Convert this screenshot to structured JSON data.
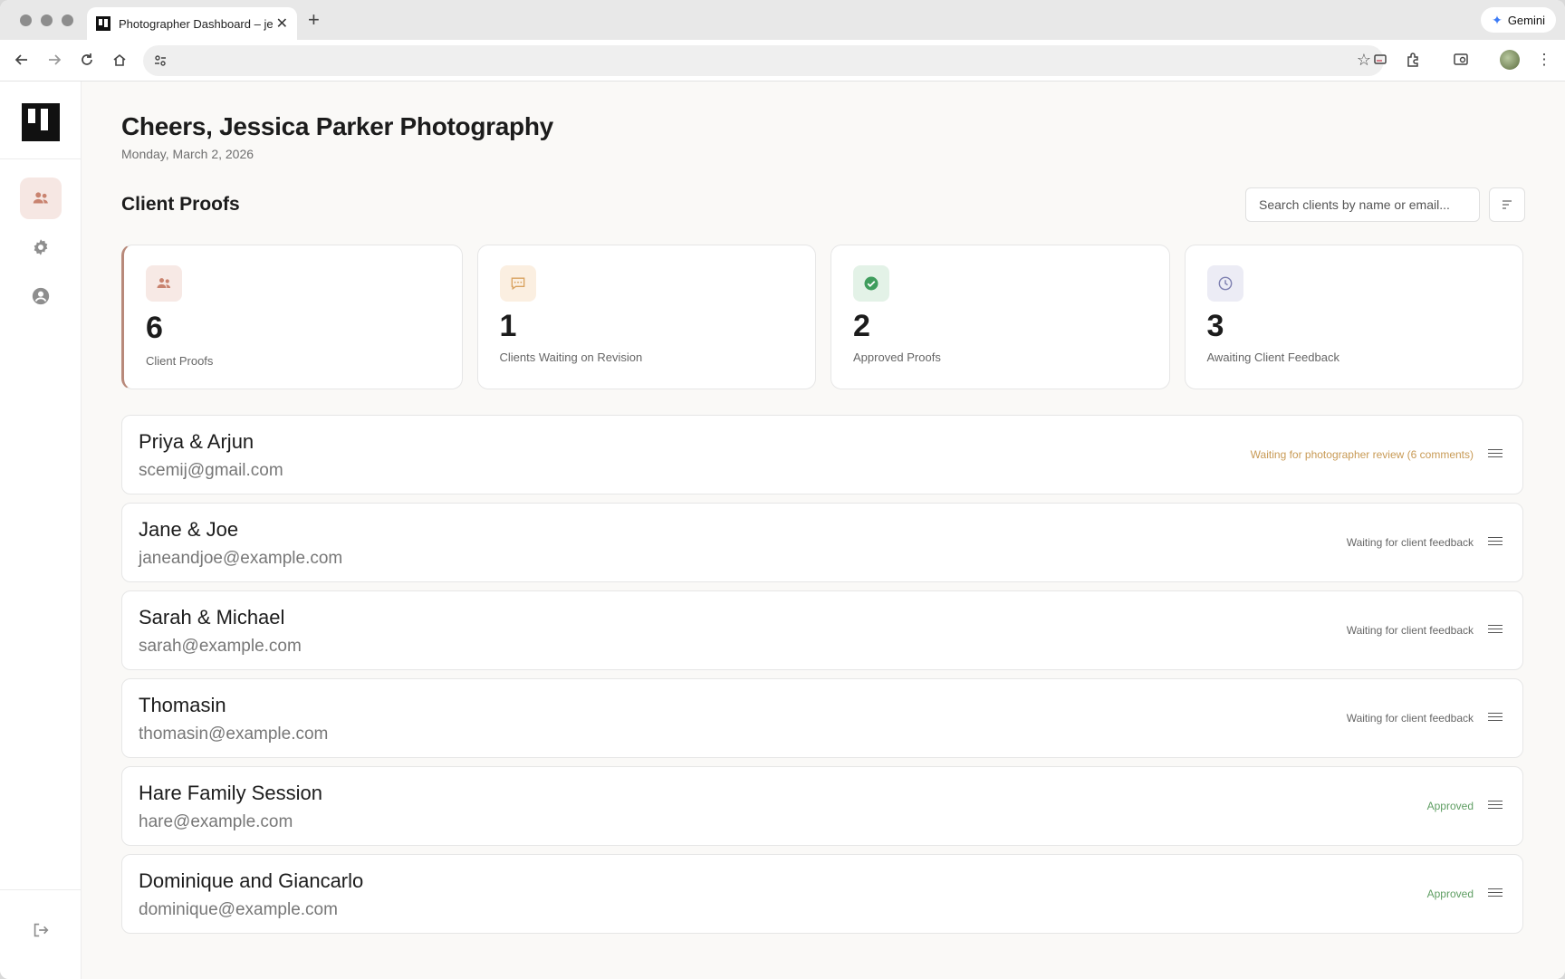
{
  "browser": {
    "tab_title": "Photographer Dashboard – je",
    "gemini_label": "Gemini"
  },
  "header": {
    "greeting": "Cheers, Jessica Parker Photography",
    "date": "Monday, March 2, 2026"
  },
  "section": {
    "title": "Client Proofs",
    "search_placeholder": "Search clients by name or email..."
  },
  "stats": [
    {
      "value": "6",
      "label": "Client Proofs",
      "icon": "users-icon",
      "color": "#c9836f",
      "bg": "#f7e9e5"
    },
    {
      "value": "1",
      "label": "Clients Waiting on Revision",
      "icon": "message-icon",
      "color": "#d9a25f",
      "bg": "#fbefe1"
    },
    {
      "value": "2",
      "label": "Approved Proofs",
      "icon": "check-circle-icon",
      "color": "#3f9d5d",
      "bg": "#e3f2e7"
    },
    {
      "value": "3",
      "label": "Awaiting Client Feedback",
      "icon": "clock-icon",
      "color": "#7d7fb0",
      "bg": "#ececf5"
    }
  ],
  "clients": [
    {
      "name": "Priya & Arjun",
      "email": "scemij@gmail.com",
      "status": "Waiting for photographer review (6 comments)",
      "status_type": "warn"
    },
    {
      "name": "Jane & Joe",
      "email": "janeandjoe@example.com",
      "status": "Waiting for client feedback",
      "status_type": "neutral"
    },
    {
      "name": "Sarah & Michael",
      "email": "sarah@example.com",
      "status": "Waiting for client feedback",
      "status_type": "neutral"
    },
    {
      "name": "Thomasin",
      "email": "thomasin@example.com",
      "status": "Waiting for client feedback",
      "status_type": "neutral"
    },
    {
      "name": "Hare Family Session",
      "email": "hare@example.com",
      "status": "Approved",
      "status_type": "ok"
    },
    {
      "name": "Dominique and Giancarlo",
      "email": "dominique@example.com",
      "status": "Approved",
      "status_type": "ok"
    }
  ],
  "colors": {
    "accent": "#b8897a",
    "warn": "#c89a55",
    "ok": "#5f9e63"
  }
}
